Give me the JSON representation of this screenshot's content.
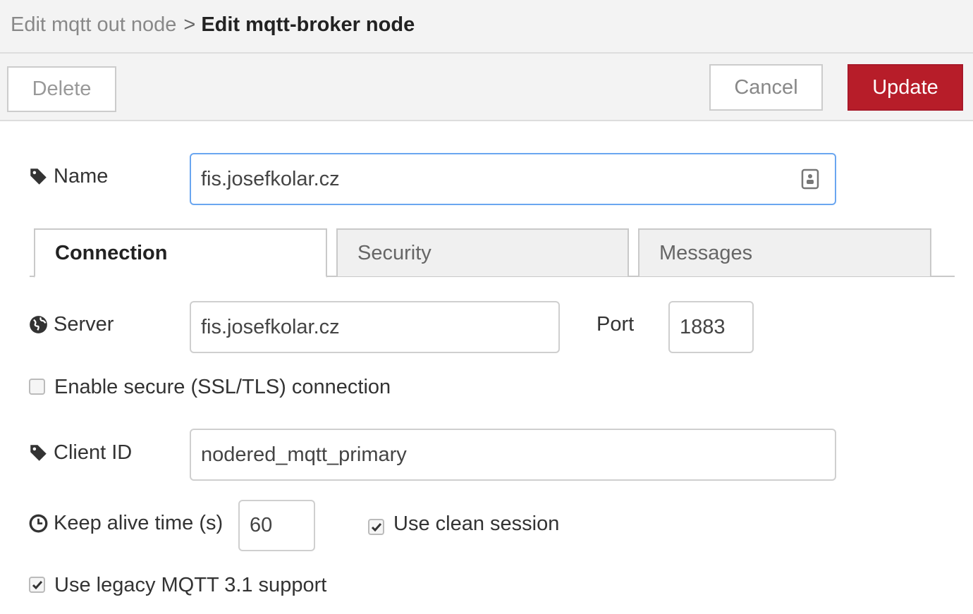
{
  "header": {
    "breadcrumb_prev": "Edit mqtt out node",
    "breadcrumb_sep": ">",
    "breadcrumb_current": "Edit mqtt-broker node"
  },
  "toolbar": {
    "delete_label": "Delete",
    "cancel_label": "Cancel",
    "update_label": "Update"
  },
  "form": {
    "name_label": "Name",
    "name_value": "fis.josefkolar.cz",
    "tabs": [
      {
        "label": "Connection",
        "active": true
      },
      {
        "label": "Security",
        "active": false
      },
      {
        "label": "Messages",
        "active": false
      }
    ],
    "server_label": "Server",
    "server_value": "fis.josefkolar.cz",
    "port_label": "Port",
    "port_value": "1883",
    "tls_label": "Enable secure (SSL/TLS) connection",
    "tls_checked": false,
    "client_id_label": "Client ID",
    "client_id_value": "nodered_mqtt_primary",
    "keepalive_label": "Keep alive time (s)",
    "keepalive_value": "60",
    "clean_session_label": "Use clean session",
    "clean_session_checked": true,
    "legacy_label": "Use legacy MQTT 3.1 support",
    "legacy_checked": true
  },
  "colors": {
    "update_button": "#b71d29",
    "focus_border": "#6aa6f0",
    "header_bg": "#f3f3f3"
  }
}
